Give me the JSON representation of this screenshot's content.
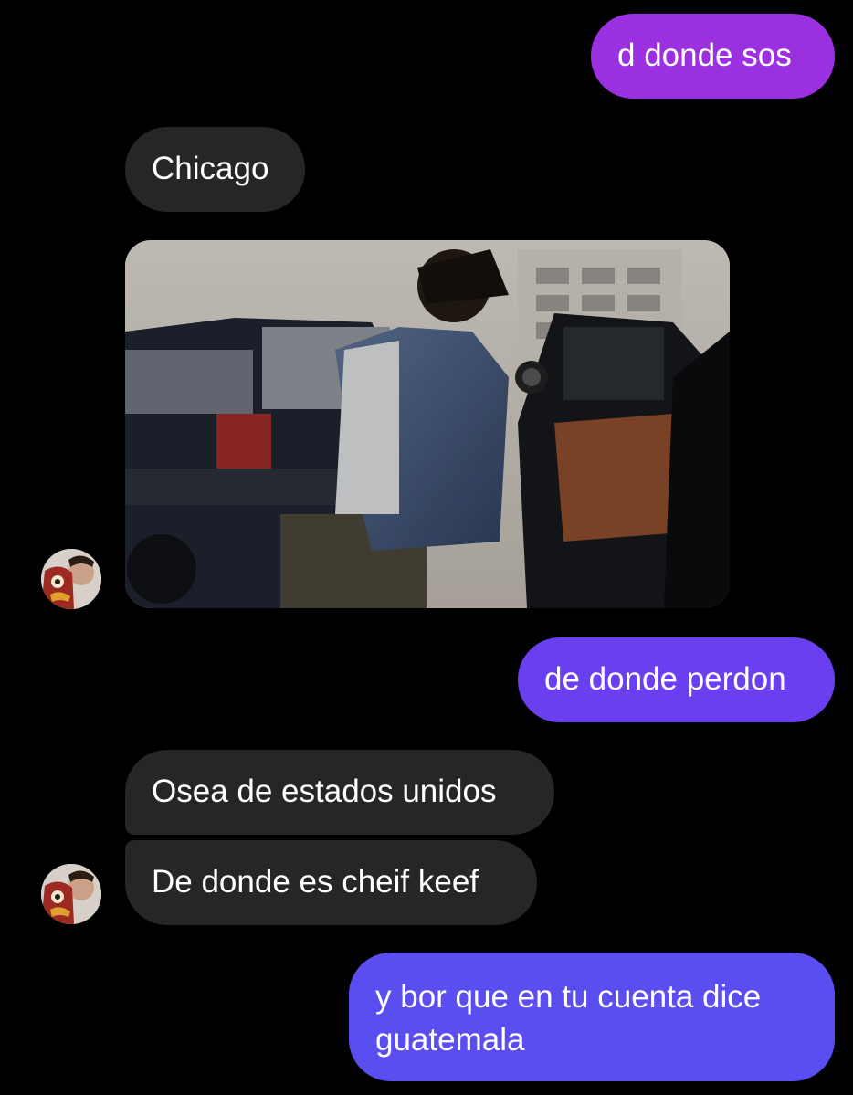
{
  "messages": [
    {
      "direction": "outgoing",
      "text": "d donde sos"
    },
    {
      "direction": "incoming",
      "text": "Chicago"
    },
    {
      "direction": "incoming",
      "type": "gif",
      "description": "animated image"
    },
    {
      "direction": "outgoing",
      "text": "de donde perdon"
    },
    {
      "direction": "incoming",
      "text": "Osea de estados unidos"
    },
    {
      "direction": "incoming",
      "text": "De donde es cheif keef"
    },
    {
      "direction": "outgoing",
      "lines": [
        "y bor que en tu cuenta dice",
        "guatemala"
      ]
    }
  ],
  "colors": {
    "background": "#000000",
    "incoming_bubble": "#262626",
    "outgoing_gradient": [
      "#9a30e0",
      "#6a3ff0",
      "#5a4ef0"
    ],
    "text": "#ffffff"
  },
  "icons": [
    "contact-avatar"
  ]
}
